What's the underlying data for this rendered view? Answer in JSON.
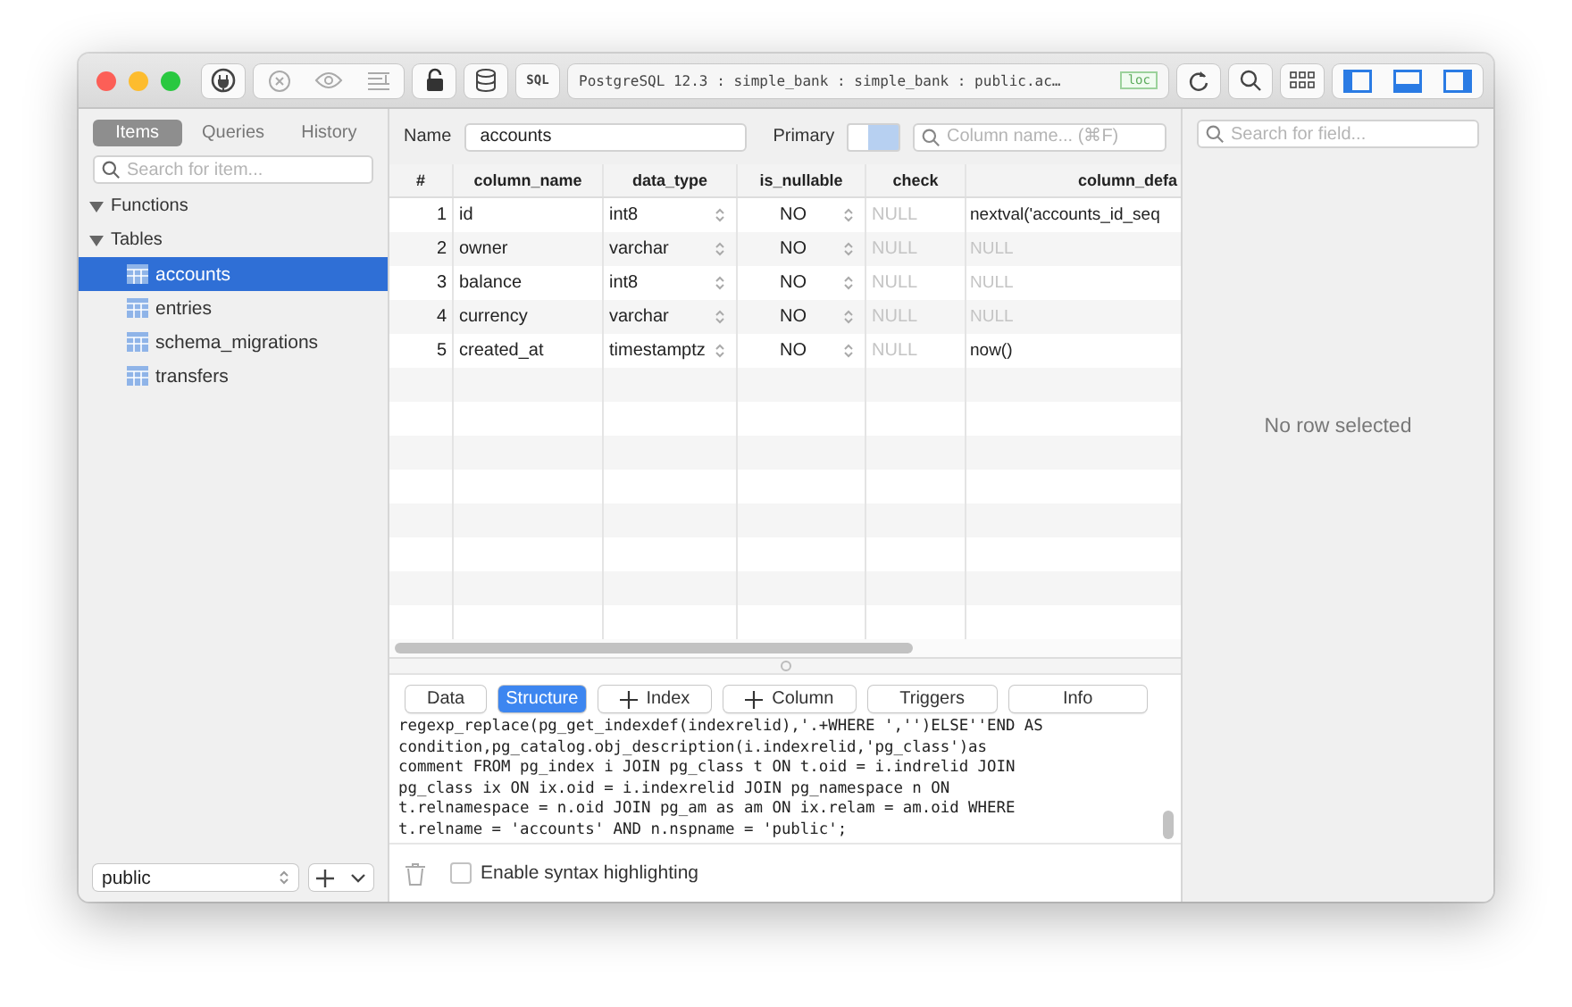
{
  "toolbar": {
    "sql_label": "SQL",
    "connection": "PostgreSQL 12.3 : simple_bank : simple_bank : public.ac…",
    "badge": "loc"
  },
  "sidebar": {
    "tabs": [
      {
        "label": "Items",
        "selected": true
      },
      {
        "label": "Queries",
        "selected": false
      },
      {
        "label": "History",
        "selected": false
      }
    ],
    "search": {
      "placeholder": "Search for item..."
    },
    "groups": [
      {
        "label": "Functions",
        "expanded": true
      },
      {
        "label": "Tables",
        "expanded": true,
        "children": [
          {
            "label": "accounts",
            "selected": true
          },
          {
            "label": "entries",
            "selected": false
          },
          {
            "label": "schema_migrations",
            "selected": false
          },
          {
            "label": "transfers",
            "selected": false
          }
        ]
      }
    ],
    "schema": "public"
  },
  "editor": {
    "name_label": "Name",
    "name": "accounts",
    "primary_label": "Primary",
    "column_search": {
      "placeholder": "Column name... (⌘F)"
    }
  },
  "table": {
    "columns": [
      "#",
      "column_name",
      "data_type",
      "is_nullable",
      "check",
      "column_defa"
    ],
    "rows": [
      {
        "num": "1",
        "column_name": "id",
        "data_type": "int8",
        "is_nullable": "NO",
        "check": {
          "text": "NULL",
          "null": true
        },
        "column_default": {
          "text": "nextval('accounts_id_seq",
          "null": false
        }
      },
      {
        "num": "2",
        "column_name": "owner",
        "data_type": "varchar",
        "is_nullable": "NO",
        "check": {
          "text": "NULL",
          "null": true
        },
        "column_default": {
          "text": "NULL",
          "null": true
        }
      },
      {
        "num": "3",
        "column_name": "balance",
        "data_type": "int8",
        "is_nullable": "NO",
        "check": {
          "text": "NULL",
          "null": true
        },
        "column_default": {
          "text": "NULL",
          "null": true
        }
      },
      {
        "num": "4",
        "column_name": "currency",
        "data_type": "varchar",
        "is_nullable": "NO",
        "check": {
          "text": "NULL",
          "null": true
        },
        "column_default": {
          "text": "NULL",
          "null": true
        }
      },
      {
        "num": "5",
        "column_name": "created_at",
        "data_type": "timestamptz",
        "is_nullable": "NO",
        "check": {
          "text": "NULL",
          "null": true
        },
        "column_default": {
          "text": "now()",
          "null": false
        }
      }
    ]
  },
  "bottom_tabs": [
    {
      "label": "Data",
      "kind": "tab",
      "selected": false
    },
    {
      "label": "Structure",
      "kind": "tab",
      "selected": true
    },
    {
      "label": "Index",
      "kind": "add",
      "selected": false
    },
    {
      "label": "Column",
      "kind": "add",
      "selected": false
    },
    {
      "label": "Triggers",
      "kind": "tab",
      "selected": false
    },
    {
      "label": "Info",
      "kind": "tab",
      "selected": false
    }
  ],
  "query": {
    "lines": [
      "regexp_replace(pg_get_indexdef(indexrelid),'.+WHERE ','')ELSE''END AS",
      "condition,pg_catalog.obj_description(i.indexrelid,'pg_class')as",
      "comment FROM pg_index i JOIN pg_class t ON t.oid = i.indrelid JOIN",
      "pg_class ix ON ix.oid = i.indexrelid JOIN pg_namespace n ON",
      "t.relnamespace = n.oid JOIN pg_am as am ON ix.relam = am.oid WHERE",
      "t.relname = 'accounts' AND n.nspname = 'public';"
    ]
  },
  "syntax_highlighting": {
    "label": "Enable syntax highlighting",
    "checked": false
  },
  "detail": {
    "search": {
      "placeholder": "Search for field..."
    },
    "empty": "No row selected"
  }
}
